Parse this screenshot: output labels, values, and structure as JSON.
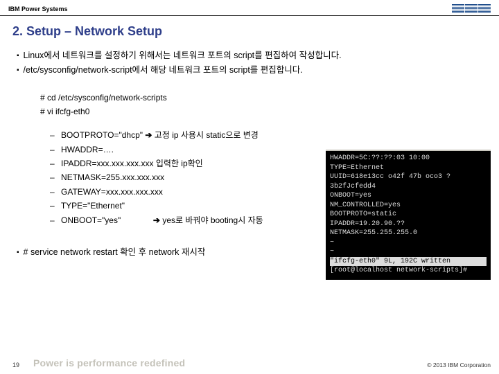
{
  "header": {
    "brand": "IBM Power Systems",
    "logo_alt": "IBM"
  },
  "title": "2. Setup – Network Setup",
  "bullets": [
    "Linux에서 네트워크를 설정하기 위해서는 네트워크 포트의 script를 편집하여 작성합니다.",
    "/etc/sysconfig/network-script에서 해당 네트워크 포트의 script를 편집합니다."
  ],
  "commands": [
    "# cd /etc/sysconfig/network-scripts",
    "# vi ifcfg-eth0"
  ],
  "params": [
    {
      "left": "BOOTPROTO=\"dhcp\"",
      "arrow": "➔",
      "right": "고정 ip 사용시 static으로 변경"
    },
    {
      "left": "HWADDR=….",
      "arrow": "",
      "right": ""
    },
    {
      "left": "IPADDR=xxx.xxx.xxx.xxx",
      "arrow": "",
      "right": " 입력한 ip확인"
    },
    {
      "left": "NETMASK=255.xxx.xxx.xxx",
      "arrow": "",
      "right": ""
    },
    {
      "left": "GATEWAY=xxx.xxx.xxx.xxx",
      "arrow": "",
      "right": ""
    },
    {
      "left": "TYPE=\"Ethernet\"",
      "arrow": "",
      "right": ""
    },
    {
      "left": "ONBOOT=\"yes\"",
      "arrow": "➔",
      "right": "yes로 바꿔야 booting시 자동"
    }
  ],
  "terminal": {
    "title": "",
    "lines": [
      "HWADDR=5C:??:??:03 10:00",
      "TYPE=Ethernet",
      "UUID=618e13cc o42f 47b oco3 ?3b2fJcfedd4",
      "ONBOOT=yes",
      "NM_CONTROLLED=yes",
      "BOOTPROTO=static",
      "IPADDR=19.20.90.??",
      "NETMASK=255.255.255.0",
      "~",
      "~"
    ],
    "status": "\"ifcfg-eth0\" 9L, 192C written",
    "prompt": "[root@localhost network-scripts]# "
  },
  "restart": "# service network restart  확인 후 network 재시작",
  "footer": {
    "page": "19",
    "tagline": "Power is performance redefined",
    "copyright": "© 2013 IBM Corporation"
  }
}
